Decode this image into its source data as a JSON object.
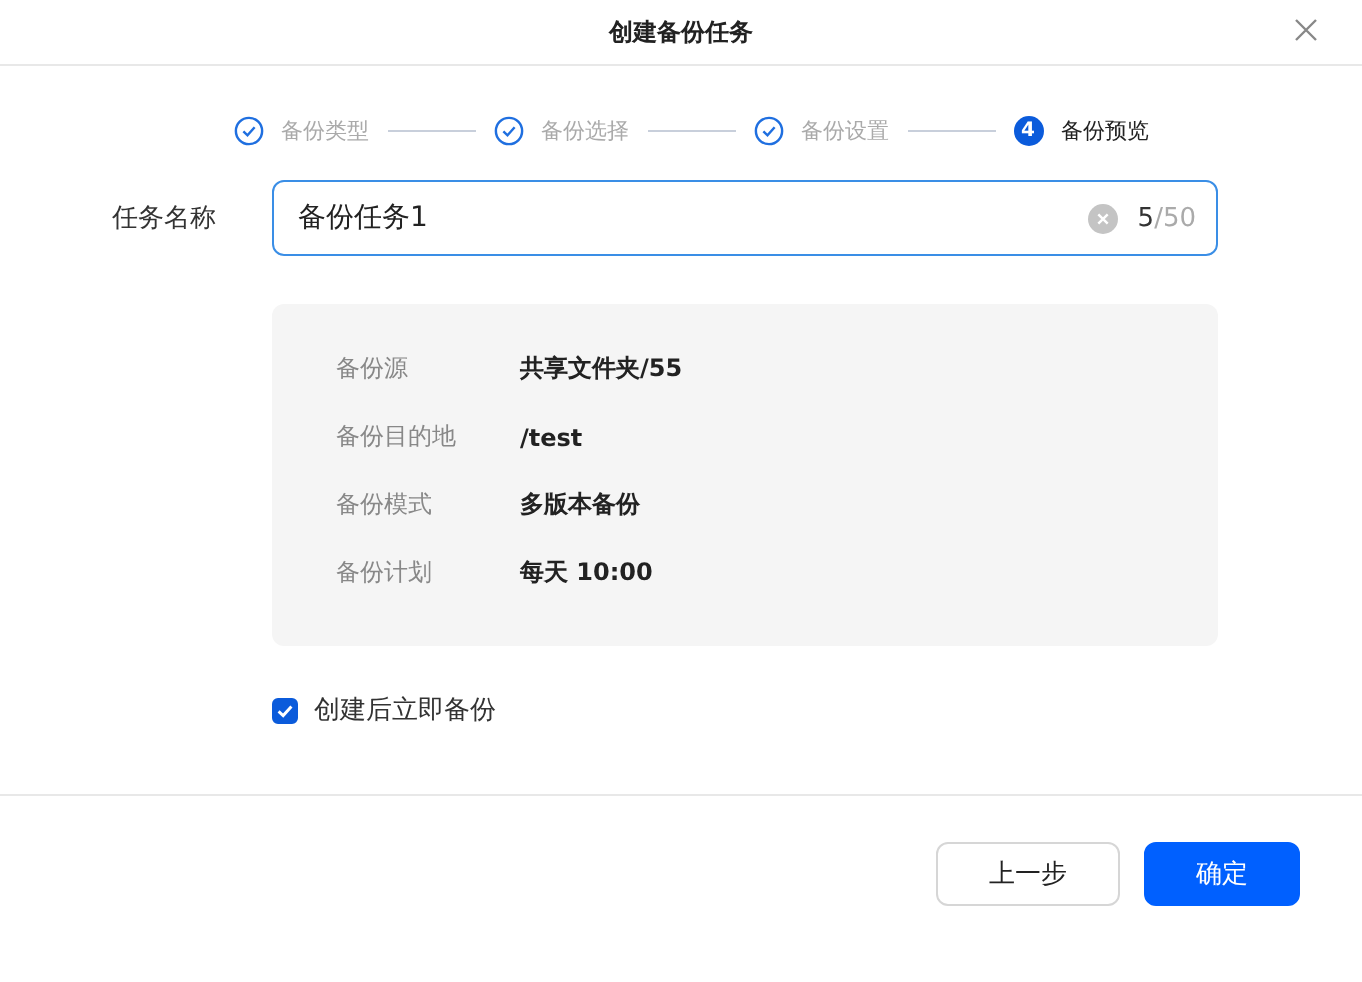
{
  "window": {
    "title": "创建备份任务"
  },
  "steps": [
    {
      "label": "备份类型",
      "completed": true,
      "selected": false
    },
    {
      "label": "备份选择",
      "completed": true,
      "selected": false
    },
    {
      "label": "备份设置",
      "completed": true,
      "selected": false
    },
    {
      "label": "备份预览",
      "completed": false,
      "selected": true,
      "number": "4"
    }
  ],
  "task_name": {
    "label": "任务名称",
    "value": "备份任务1",
    "count": "5",
    "max": "/50"
  },
  "summary": [
    {
      "label": "备份源",
      "value": "共享文件夹/55"
    },
    {
      "label": "备份目的地",
      "value": "/test"
    },
    {
      "label": "备份模式",
      "value": "多版本备份"
    },
    {
      "label": "备份计划",
      "value": "每天 10:00"
    }
  ],
  "backup_now": {
    "label": "创建后立即备份",
    "checked": true
  },
  "buttons": [
    {
      "label": "上一步",
      "kind": "secondary"
    },
    {
      "label": "确定",
      "kind": "primary"
    }
  ]
}
